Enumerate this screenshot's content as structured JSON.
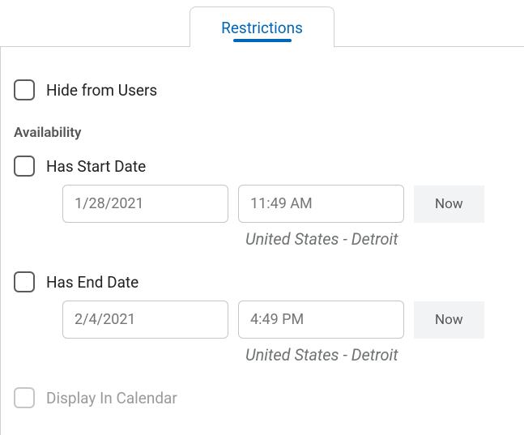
{
  "tab": {
    "label": "Restrictions"
  },
  "hideFromUsers": {
    "label": "Hide from Users"
  },
  "availability": {
    "header": "Availability",
    "start": {
      "label": "Has Start Date",
      "date_placeholder": "1/28/2021",
      "time_placeholder": "11:49 AM",
      "now_label": "Now",
      "timezone": "United States - Detroit"
    },
    "end": {
      "label": "Has End Date",
      "date_placeholder": "2/4/2021",
      "time_placeholder": "4:49 PM",
      "now_label": "Now",
      "timezone": "United States - Detroit"
    },
    "displayInCalendar": {
      "label": "Display In Calendar"
    }
  }
}
